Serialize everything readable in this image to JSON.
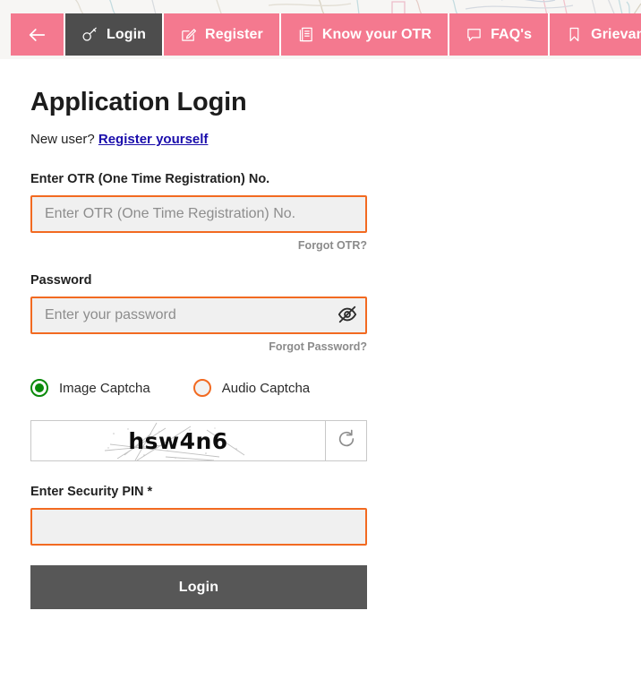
{
  "navbar": {
    "back_icon": "arrow-left-icon",
    "tabs": [
      {
        "label": "Login",
        "icon": "key-icon",
        "active": true
      },
      {
        "label": "Register",
        "icon": "edit-square-icon",
        "active": false
      },
      {
        "label": "Know your OTR",
        "icon": "document-icon",
        "active": false
      },
      {
        "label": "FAQ's",
        "icon": "chat-bubble-icon",
        "active": false
      },
      {
        "label": "Grievance",
        "icon": "bookmark-icon",
        "active": false
      }
    ],
    "bg_color": "#f4798f",
    "active_color": "#4d4d4d"
  },
  "main": {
    "title": "Application Login",
    "new_user_text": "New user?",
    "register_link": "Register yourself",
    "otr": {
      "label": "Enter OTR (One Time Registration) No.",
      "placeholder": "Enter OTR (One Time Registration) No.",
      "value": "",
      "helper": "Forgot OTR?"
    },
    "password": {
      "label": "Password",
      "placeholder": "Enter your password",
      "value": "",
      "helper": "Forgot Password?",
      "toggle_icon": "eye-slash-icon"
    },
    "captcha": {
      "options": [
        {
          "label": "Image Captcha",
          "selected": true
        },
        {
          "label": "Audio Captcha",
          "selected": false
        }
      ],
      "image_text": "hsw4n6",
      "refresh_icon": "refresh-icon"
    },
    "pin": {
      "label": "Enter Security PIN *",
      "placeholder": "",
      "value": ""
    },
    "submit_label": "Login"
  },
  "colors": {
    "accent_pink": "#f4798f",
    "input_border_orange": "#f26a21",
    "input_fill": "#f0f0f0",
    "link_blue": "#1a0dab",
    "radio_green": "#0a8a0a",
    "button_gray": "#575757"
  }
}
